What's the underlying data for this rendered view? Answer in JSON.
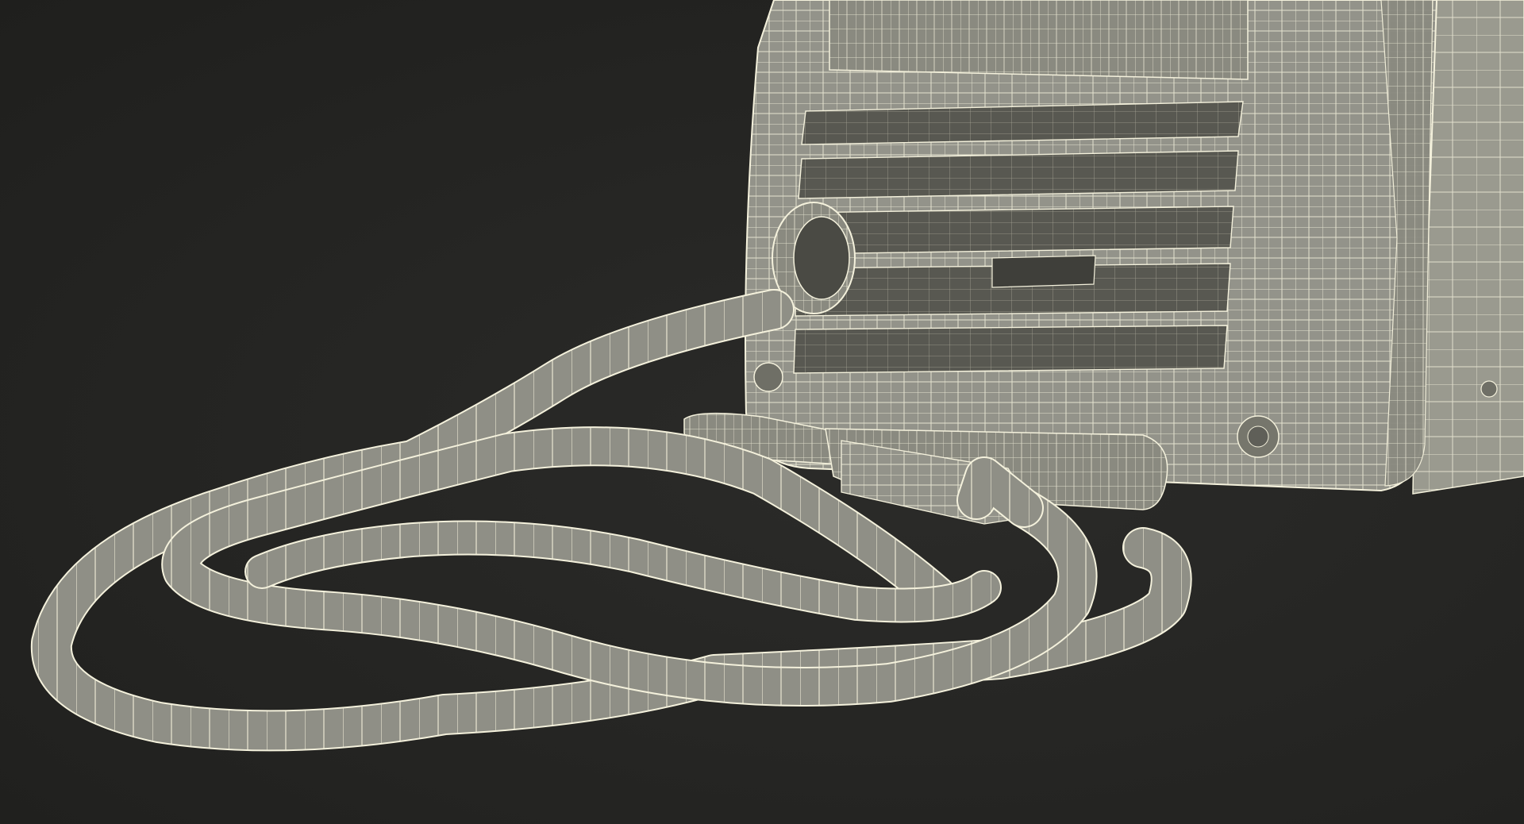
{
  "scene": {
    "subject": "welder-wireframe-render",
    "colors": {
      "background": "#252523",
      "surface": "#8f8f84",
      "surface_light": "#a3a396",
      "surface_dark": "#6f6f66",
      "wire": "#f4f1dc",
      "slot": "#55554e"
    }
  }
}
